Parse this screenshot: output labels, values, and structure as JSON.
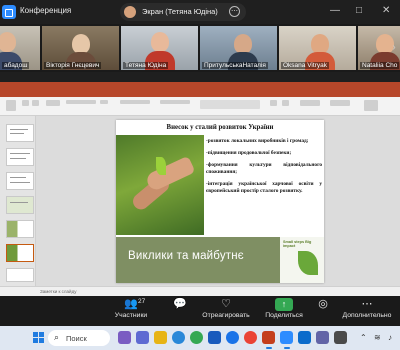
{
  "zoom": {
    "app_title": "Конференция",
    "share_status": "Экран (Тетяна Юдіна)",
    "window_controls": {
      "minimize": "—",
      "maximize": "□",
      "close": "✕"
    }
  },
  "gallery": {
    "participants": [
      {
        "name": "абадош"
      },
      {
        "name": "Вікторія Гнєцевич"
      },
      {
        "name": "Тетяна Юдіна"
      },
      {
        "name": "ПритульськаНаталія"
      },
      {
        "name": "Oksana Vitryak"
      },
      {
        "name": "Nataliia Cho"
      }
    ]
  },
  "slide": {
    "title": "Внесок у сталий розвиток України",
    "bullets": [
      "-розвиток локальних виробників і громад;",
      "-підвищення продовольчої безпеки;",
      "-формування культури відповідального споживання;",
      "-інтеграція української харчової освіти у європейський простір сталого розвитку."
    ],
    "banner_text": "Виклики та майбутнє",
    "logo_text": "Small steps Big impact"
  },
  "powerpoint": {
    "notes_label": "Заметки к слайду"
  },
  "toolbar": {
    "participants_label": "Участники",
    "participants_count": "27",
    "react_label": "Отреагировать",
    "share_label": "Поделиться",
    "more_label": "Дополнительно"
  },
  "taskbar": {
    "search_placeholder": "Поиск"
  }
}
